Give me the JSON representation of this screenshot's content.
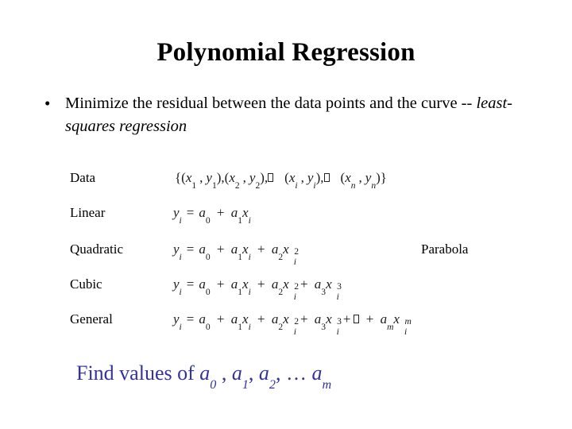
{
  "slide": {
    "title": "Polynomial Regression",
    "bullet": {
      "marker": "•",
      "text_before": "Minimize the residual between the data points and the curve -- ",
      "text_emphasis": "least-squares regression"
    },
    "rows": [
      {
        "label": "Data",
        "equation_plain": "{(x1, y1),(x2, y2),…  (xi, yi),…  (xn, yn)}",
        "note": ""
      },
      {
        "label": "Linear",
        "equation_plain": "yi = a0 + a1xi",
        "note": ""
      },
      {
        "label": "Quadratic",
        "equation_plain": "yi = a0 + a1xi + a2xi^2",
        "note": "Parabola"
      },
      {
        "label": "Cubic",
        "equation_plain": "yi = a0 + a1xi + a2xi^2 + a3xi^3",
        "note": ""
      },
      {
        "label": "General",
        "equation_plain": "yi = a0 + a1xi + a2xi^2 + a3xi^3 +… + amxi^m",
        "note": ""
      }
    ],
    "conclusion": {
      "lead": "Find values of ",
      "a0": "a",
      "a0_sub": "0",
      "sep1": " , ",
      "a1": "a",
      "a1_sub": "1",
      "sep2": ", ",
      "a2": "a",
      "a2_sub": "2",
      "sep3": ", … ",
      "am": "a",
      "am_sub": "m",
      "color": "#333399"
    }
  }
}
